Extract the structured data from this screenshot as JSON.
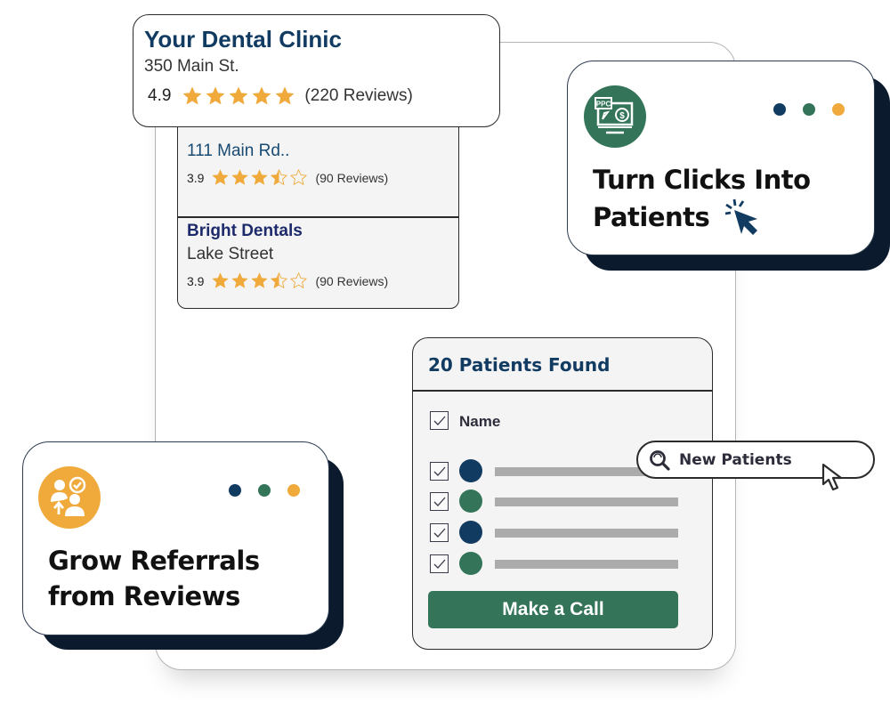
{
  "colors": {
    "navy": "#123b62",
    "green": "#34755a",
    "gold": "#f0aa3c",
    "shadow": "#0c1a2e"
  },
  "main_listing": {
    "title": "Your Dental Clinic",
    "address": "350 Main St.",
    "rating": "4.9",
    "stars": 5,
    "reviews": "(220 Reviews)"
  },
  "listings": [
    {
      "address": "111 Main Rd..",
      "rating": "3.9",
      "stars": 3.5,
      "reviews": "(90 Reviews)"
    },
    {
      "name": "Bright Dentals",
      "address": "Lake Street",
      "rating": "3.9",
      "stars": 3.5,
      "reviews": "(90 Reviews)"
    }
  ],
  "feature_cards": [
    {
      "icon": "ppc-monitor-icon",
      "icon_text": "PPC",
      "title_line1": "Turn Clicks Into",
      "title_line2": "Patients",
      "accessory_icon": "click-cursor-icon"
    },
    {
      "icon": "referral-people-icon",
      "title_line1": "Grow Referrals",
      "title_line2": "from Reviews"
    }
  ],
  "patients_panel": {
    "title": "20 Patients Found",
    "column_header": "Name",
    "rows": [
      {
        "checked": true,
        "avatar_color": "#123b62"
      },
      {
        "checked": true,
        "avatar_color": "#34755a"
      },
      {
        "checked": true,
        "avatar_color": "#123b62"
      },
      {
        "checked": true,
        "avatar_color": "#34755a"
      }
    ],
    "action_button": "Make a Call"
  },
  "search_pill": {
    "icon": "search-icon",
    "label": "New Patients"
  }
}
